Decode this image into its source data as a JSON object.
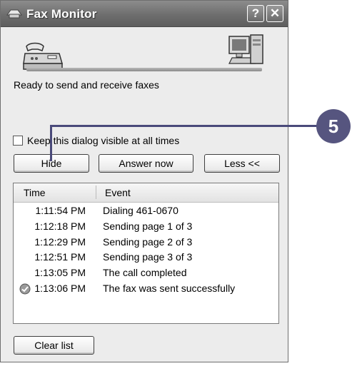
{
  "window": {
    "title": "Fax Monitor",
    "icon": "fax-window-icon",
    "help_label": "?",
    "close_label": "✕"
  },
  "status": {
    "text": "Ready to send and receive faxes",
    "left_icon": "fax-machine-icon",
    "right_icon": "computer-icon"
  },
  "options": {
    "keep_visible_label": "Keep this dialog visible at all times",
    "keep_visible_checked": false
  },
  "buttons": {
    "hide": "Hide",
    "answer_now": "Answer now",
    "less": "Less <<",
    "clear_list": "Clear list"
  },
  "event_list": {
    "columns": [
      "Time",
      "Event"
    ],
    "rows": [
      {
        "time": "1:11:54 PM",
        "event": "Dialing 461-0670",
        "icon": ""
      },
      {
        "time": "1:12:18 PM",
        "event": "Sending page 1 of 3",
        "icon": ""
      },
      {
        "time": "1:12:29 PM",
        "event": "Sending page 2 of 3",
        "icon": ""
      },
      {
        "time": "1:12:51 PM",
        "event": "Sending page 3 of 3",
        "icon": ""
      },
      {
        "time": "1:13:05 PM",
        "event": "The call completed",
        "icon": ""
      },
      {
        "time": "1:13:06 PM",
        "event": "The fax was sent successfully",
        "icon": "success-check-icon"
      }
    ]
  },
  "callout": {
    "number": "5",
    "color": "#56557f"
  }
}
